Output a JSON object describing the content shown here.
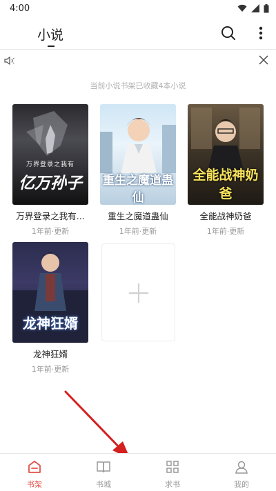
{
  "status_bar": {
    "time": "4:00"
  },
  "header": {
    "title": "小说"
  },
  "shelf": {
    "summary": "当前小说书架已收藏4本小说",
    "books": [
      {
        "title": "万界登录之我有...",
        "update": "1年前·更新",
        "cover_text": "亿万孙子",
        "cover_top": "万界登录之我有"
      },
      {
        "title": "重生之魔道蛊仙",
        "update": "1年前·更新",
        "cover_text": "重生之魔道蛊仙"
      },
      {
        "title": "全能战神奶爸",
        "update": "1年前·更新",
        "cover_text": "全能战神奶爸"
      },
      {
        "title": "龙神狂婿",
        "update": "1年前·更新",
        "cover_text": "龙神狂婿"
      }
    ]
  },
  "bottom_nav": {
    "items": [
      {
        "label": "书架",
        "icon": "bookshelf-icon",
        "active": true
      },
      {
        "label": "书城",
        "icon": "open-book-icon",
        "active": false
      },
      {
        "label": "求书",
        "icon": "grid-icon",
        "active": false
      },
      {
        "label": "我的",
        "icon": "person-icon",
        "active": false
      }
    ]
  },
  "colors": {
    "accent": "#e0524b",
    "arrow": "#d42020"
  }
}
